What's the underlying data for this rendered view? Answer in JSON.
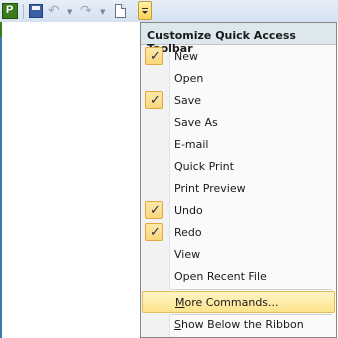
{
  "toolbar": {
    "app_icon_letter": "P",
    "buttons": [
      {
        "icon": "project-app-icon"
      },
      {
        "icon": "save-icon"
      },
      {
        "icon": "undo-icon"
      },
      {
        "icon": "redo-icon"
      },
      {
        "icon": "new-document-icon"
      },
      {
        "icon": "customize-dropdown-icon"
      }
    ]
  },
  "menu": {
    "title": "Customize Quick Access Toolbar",
    "items": [
      {
        "label": "New",
        "checked": true
      },
      {
        "label": "Open",
        "checked": false
      },
      {
        "label": "Save",
        "checked": true
      },
      {
        "label": "Save As",
        "checked": false
      },
      {
        "label": "E-mail",
        "checked": false
      },
      {
        "label": "Quick Print",
        "checked": false
      },
      {
        "label": "Print Preview",
        "checked": false
      },
      {
        "label": "Undo",
        "checked": true
      },
      {
        "label": "Redo",
        "checked": true
      },
      {
        "label": "View",
        "checked": false
      },
      {
        "label": "Open Recent File",
        "checked": false
      }
    ],
    "more_commands": {
      "accel": "M",
      "rest": "ore Commands..."
    },
    "show_below": {
      "accel": "S",
      "rest": "how Below the Ribbon"
    },
    "checkmark": "✓"
  }
}
